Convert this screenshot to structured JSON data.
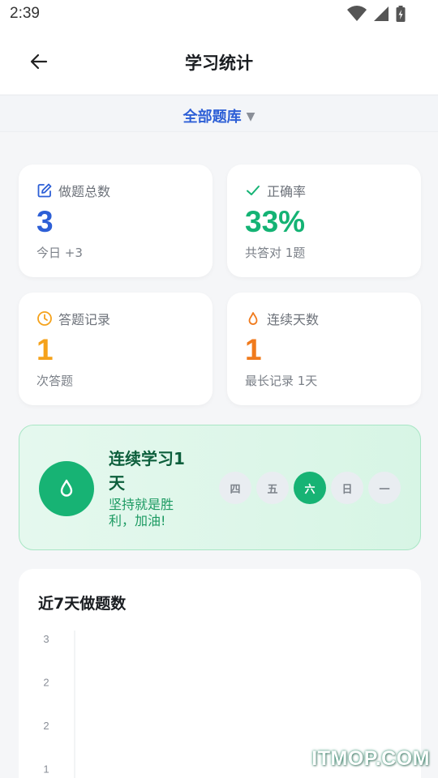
{
  "status_bar": {
    "time": "2:39"
  },
  "app_bar": {
    "title": "学习统计"
  },
  "filter": {
    "label": "全部题库",
    "caret": "▼"
  },
  "stats": [
    {
      "id": "total",
      "icon": "edit-icon",
      "label": "做题总数",
      "value": "3",
      "sub": "今日 +3",
      "color": "#2d5fd6"
    },
    {
      "id": "accuracy",
      "icon": "check-icon",
      "label": "正确率",
      "value": "33%",
      "sub": "共答对 1题",
      "color": "#14b374"
    },
    {
      "id": "records",
      "icon": "clock-icon",
      "label": "答题记录",
      "value": "1",
      "sub": "次答题",
      "color": "#f5a21b"
    },
    {
      "id": "streak",
      "icon": "flame-icon",
      "label": "连续天数",
      "value": "1",
      "sub": "最长记录 1天",
      "color": "#f07a1c"
    }
  ],
  "streak_banner": {
    "title": "连续学习1天",
    "subtitle": "坚持就是胜利，加油!",
    "days": [
      {
        "label": "四",
        "active": false
      },
      {
        "label": "五",
        "active": false
      },
      {
        "label": "六",
        "active": true
      },
      {
        "label": "日",
        "active": false
      },
      {
        "label": "一",
        "active": false
      }
    ]
  },
  "chart_data": {
    "type": "bar",
    "title": "近7天做题数",
    "ytick_labels": [
      "3",
      "2",
      "2",
      "1"
    ],
    "categories": [],
    "values": []
  },
  "watermark": "ITMOP.COM"
}
